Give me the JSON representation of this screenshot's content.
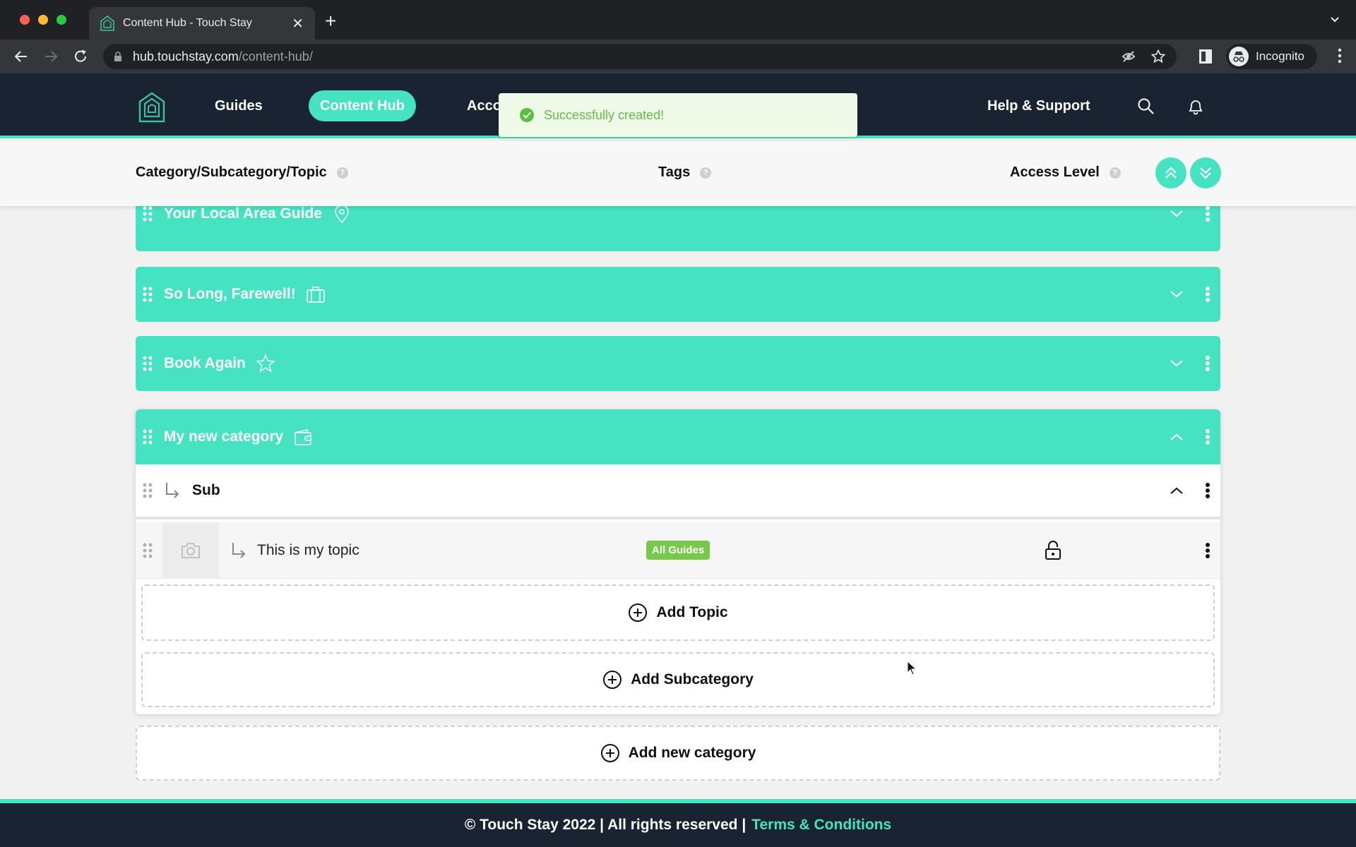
{
  "browser": {
    "tab_title": "Content Hub - Touch Stay",
    "url_host": "hub.touchstay.com",
    "url_path": "/content-hub/",
    "profile_label": "Incognito"
  },
  "header": {
    "nav": [
      {
        "label": "Guides"
      },
      {
        "label": "Content Hub",
        "active": true
      },
      {
        "label": "Account"
      }
    ],
    "help_label": "Help & Support"
  },
  "toast": {
    "message": "Successfully created!",
    "type": "success"
  },
  "columns": {
    "category": "Category/Subcategory/Topic",
    "tags": "Tags",
    "access": "Access Level",
    "help_glyph": "?"
  },
  "categories": [
    {
      "title": "Your Local Area Guide",
      "icon": "map-pin-icon",
      "expanded": false
    },
    {
      "title": "So Long, Farewell!",
      "icon": "suitcase-icon",
      "expanded": false
    },
    {
      "title": "Book Again",
      "icon": "star-icon",
      "expanded": false
    },
    {
      "title": "My new category",
      "icon": "wallet-icon",
      "expanded": true
    }
  ],
  "expanded_category": {
    "subcategory": {
      "title": "Sub",
      "expanded": true
    },
    "topic": {
      "title": "This is my topic",
      "tag": "All Guides",
      "access": "unlocked"
    },
    "add_topic_label": "Add Topic",
    "add_subcategory_label": "Add Subcategory"
  },
  "add_category_label": "Add new category",
  "footer": {
    "text": "© Touch Stay 2022 | All rights reserved |",
    "link": "Terms & Conditions"
  },
  "colors": {
    "brand_teal": "#45e3c2",
    "header_navy": "#1a2331",
    "success_green": "#62be45",
    "tag_green": "#77c94a"
  }
}
